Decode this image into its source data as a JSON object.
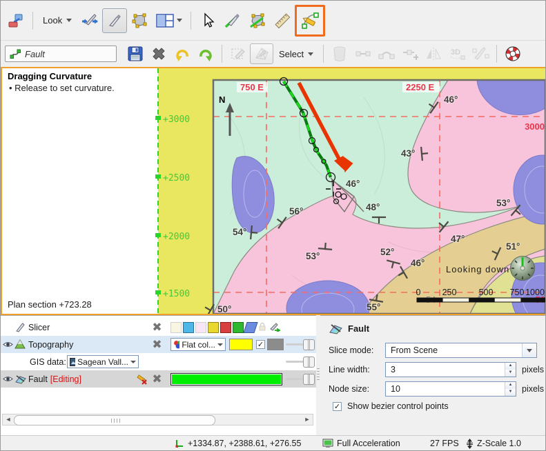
{
  "toolbar1": {
    "look": "Look"
  },
  "toolbar2": {
    "fault_name": "Fault",
    "select": "Select"
  },
  "scene": {
    "overlay": {
      "title": "Dragging Curvature",
      "bullet": "• Release to set curvature."
    },
    "plan_label": "Plan section +723.28",
    "north": "N",
    "looking_down": "Looking down",
    "grid": {
      "e750": "750 E",
      "e2250": "2250 E",
      "n3000": "3000",
      "n50": "50",
      "s3000": "+3000",
      "s2500": "+2500",
      "s2000": "+2000",
      "s1500": "+1500"
    },
    "dips": [
      {
        "label": "46°"
      },
      {
        "label": "43°"
      },
      {
        "label": "46°"
      },
      {
        "label": "48°"
      },
      {
        "label": "56°"
      },
      {
        "label": "54°"
      },
      {
        "label": "53°"
      },
      {
        "label": "52°"
      },
      {
        "label": "47°"
      },
      {
        "label": "53°"
      },
      {
        "label": "51°"
      },
      {
        "label": "46°"
      },
      {
        "label": "50°"
      },
      {
        "label": "55°"
      }
    ],
    "faint_label": "54",
    "scalebar": [
      "0",
      "250",
      "500",
      "750",
      "1000"
    ]
  },
  "layers": {
    "slicer": {
      "label": "Slicer"
    },
    "topography": {
      "label": "Topography",
      "shading": "Flat col...",
      "swatch_color": "#ffff00"
    },
    "gis": {
      "label": "GIS data:",
      "value": "Sagean Vall..."
    },
    "fault": {
      "label": "Fault",
      "status": "[Editing]",
      "color": "#00ef00"
    }
  },
  "props": {
    "title": "Fault",
    "slice_mode": {
      "label": "Slice mode:",
      "value": "From Scene"
    },
    "line_width": {
      "label": "Line width:",
      "value": "3",
      "unit": "pixels"
    },
    "node_size": {
      "label": "Node size:",
      "value": "10",
      "unit": "pixels"
    },
    "bezier": {
      "label": "Show bezier control points"
    }
  },
  "statusbar": {
    "coords": "+1334.87, +2388.61, +276.55",
    "accel": "Full Acceleration",
    "fps": "27 FPS",
    "zscale": "Z-Scale 1.0"
  }
}
